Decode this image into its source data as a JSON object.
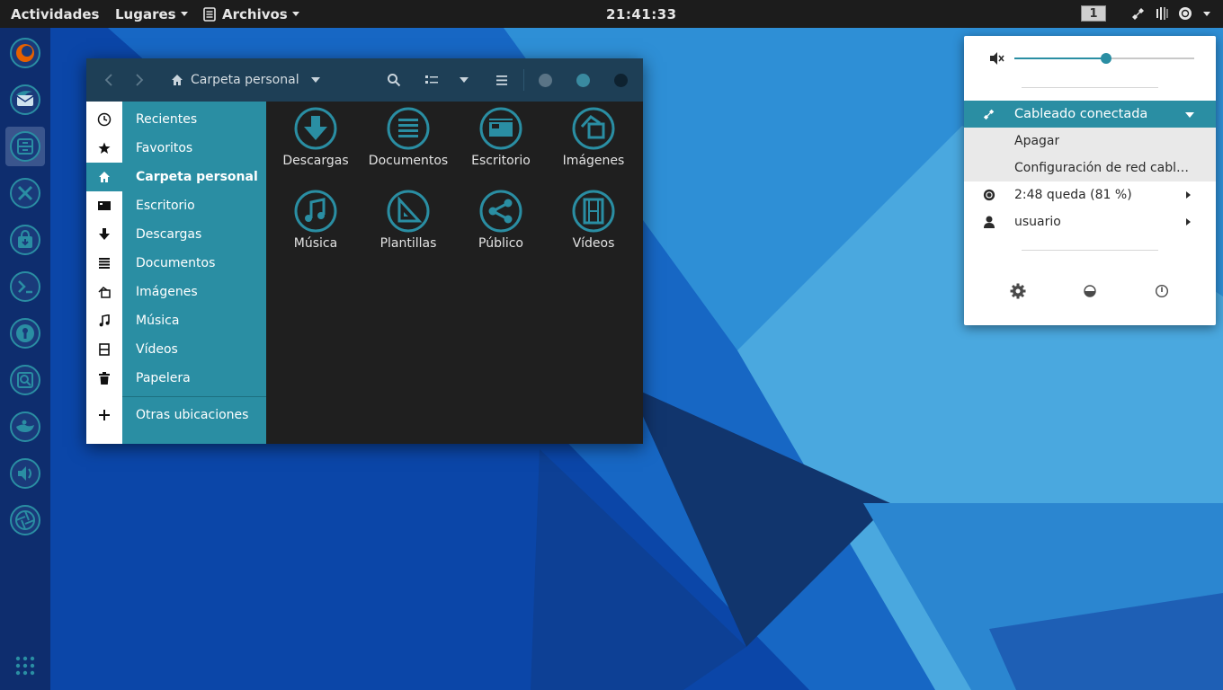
{
  "topbar": {
    "activities": "Actividades",
    "places": "Lugares",
    "app_menu": "Archivos",
    "clock": "21:41:33",
    "workspace": "1"
  },
  "dock": {
    "apps": [
      {
        "name": "firefox-icon",
        "color": "#e66000"
      },
      {
        "name": "thunderbird-icon",
        "color": "#1f6dbb"
      },
      {
        "name": "files-icon",
        "color": "#2a8ea3",
        "active": true
      },
      {
        "name": "tools-icon",
        "color": "#2a8ea3"
      },
      {
        "name": "software-store-icon",
        "color": "#2a8ea3"
      },
      {
        "name": "terminal-icon",
        "color": "#2a8ea3"
      },
      {
        "name": "passwords-icon",
        "color": "#2a8ea3"
      },
      {
        "name": "image-viewer-icon",
        "color": "#2a8ea3"
      },
      {
        "name": "genie-lamp-icon",
        "color": "#2a8ea3"
      },
      {
        "name": "sound-icon",
        "color": "#2a8ea3"
      },
      {
        "name": "aperture-icon",
        "color": "#2a8ea3"
      }
    ],
    "show_apps": "grid-icon"
  },
  "file_manager": {
    "path_label": "Carpeta personal",
    "sidebar": [
      {
        "icon": "clock-icon",
        "label": "Recientes"
      },
      {
        "icon": "star-icon",
        "label": "Favoritos"
      },
      {
        "icon": "home-icon",
        "label": "Carpeta personal",
        "selected": true
      },
      {
        "icon": "desktop-icon",
        "label": "Escritorio"
      },
      {
        "icon": "download-icon",
        "label": "Descargas"
      },
      {
        "icon": "documents-icon",
        "label": "Documentos"
      },
      {
        "icon": "pictures-icon",
        "label": "Imágenes"
      },
      {
        "icon": "music-icon",
        "label": "Música"
      },
      {
        "icon": "videos-icon",
        "label": "Vídeos"
      },
      {
        "icon": "trash-icon",
        "label": "Papelera"
      }
    ],
    "other_locations": "Otras ubicaciones",
    "folders": [
      {
        "icon": "download-folder-icon",
        "label": "Descargas"
      },
      {
        "icon": "documents-folder-icon",
        "label": "Documentos"
      },
      {
        "icon": "desktop-folder-icon",
        "label": "Escritorio"
      },
      {
        "icon": "pictures-folder-icon",
        "label": "Imágenes"
      },
      {
        "icon": "music-folder-icon",
        "label": "Música"
      },
      {
        "icon": "templates-folder-icon",
        "label": "Plantillas"
      },
      {
        "icon": "public-folder-icon",
        "label": "Público"
      },
      {
        "icon": "videos-folder-icon",
        "label": "Vídeos"
      }
    ]
  },
  "system_menu": {
    "volume_level": 0.51,
    "wired": "Cableado conectada",
    "wired_off": "Apagar",
    "wired_settings": "Configuración de red cableada",
    "battery": "2:48 queda (81 %)",
    "user": "usuario"
  },
  "colors": {
    "accent": "#2a8ea3",
    "topbar": "#1c1c1c",
    "headerbar": "#1e3f56",
    "content_bg": "#1f1f1f"
  }
}
